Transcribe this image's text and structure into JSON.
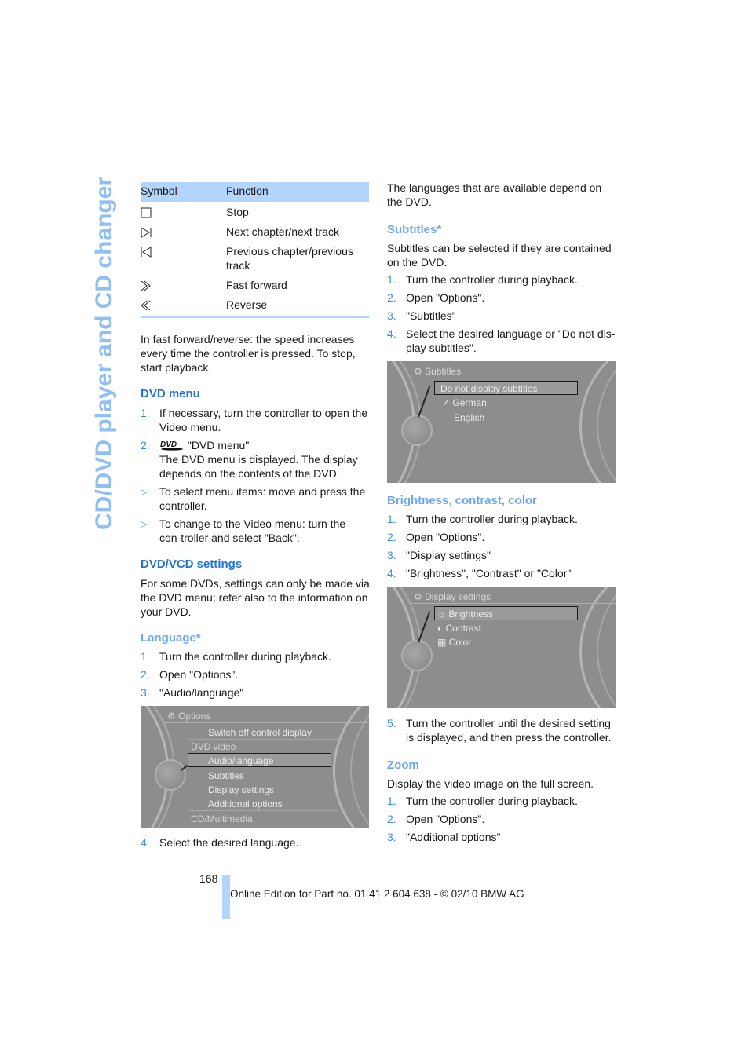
{
  "side_title": "CD/DVD player and CD changer",
  "symbol_table": {
    "headers": [
      "Symbol",
      "Function"
    ],
    "rows": [
      {
        "icon": "stop-icon",
        "function": "Stop"
      },
      {
        "icon": "next-track-icon",
        "function": "Next chapter/next track"
      },
      {
        "icon": "previous-track-icon",
        "function": "Previous chapter/previous track"
      },
      {
        "icon": "fast-forward-icon",
        "function": "Fast forward"
      },
      {
        "icon": "reverse-icon",
        "function": "Reverse"
      }
    ]
  },
  "left": {
    "intro": "In fast forward/reverse: the speed increases every time the controller is pressed. To stop, start playback.",
    "dvd_menu": {
      "heading": "DVD menu",
      "steps": [
        {
          "num": "1.",
          "text": "If necessary, turn the controller to open the Video menu."
        },
        {
          "num": "2.",
          "text": "\"DVD menu\"",
          "sub": "The DVD menu is displayed. The display depends on the contents of the DVD."
        }
      ],
      "bullets": [
        "To select menu items: move and press the controller.",
        "To change to the Video menu: turn the con-troller and select \"Back\"."
      ]
    },
    "dvd_vcd": {
      "heading": "DVD/VCD settings",
      "text": "For some DVDs, settings can only be made via the DVD menu; refer also to the information on your DVD."
    },
    "language": {
      "heading": "Language*",
      "steps": [
        {
          "num": "1.",
          "text": "Turn the controller during playback."
        },
        {
          "num": "2.",
          "text": "Open \"Options\"."
        },
        {
          "num": "3.",
          "text": "\"Audio/language\""
        }
      ],
      "screen": {
        "title": "Options",
        "items": [
          "Switch off control display",
          "DVD video",
          "Audio/language",
          "Subtitles",
          "Display settings",
          "Additional options",
          "CD/Multimedia"
        ],
        "selected": "Audio/language"
      },
      "after": {
        "num": "4.",
        "text": "Select the desired language."
      }
    }
  },
  "right": {
    "intro": "The languages that are available depend on the DVD.",
    "subtitles": {
      "heading": "Subtitles*",
      "text": "Subtitles can be selected if they are contained on the DVD.",
      "steps": [
        {
          "num": "1.",
          "text": "Turn the controller during playback."
        },
        {
          "num": "2.",
          "text": "Open \"Options\"."
        },
        {
          "num": "3.",
          "text": "\"Subtitles\""
        },
        {
          "num": "4.",
          "text": "Select the desired language or \"Do not dis-play subtitles\"."
        }
      ],
      "screen": {
        "title": "Subtitles",
        "items": [
          "Do not display subtitles",
          "German",
          "English"
        ],
        "selected": "Do not display subtitles",
        "checked": "German"
      }
    },
    "brightness": {
      "heading": "Brightness, contrast, color",
      "steps": [
        {
          "num": "1.",
          "text": "Turn the controller during playback."
        },
        {
          "num": "2.",
          "text": "Open \"Options\"."
        },
        {
          "num": "3.",
          "text": "\"Display settings\""
        },
        {
          "num": "4.",
          "text": "\"Brightness\", \"Contrast\" or \"Color\""
        }
      ],
      "screen": {
        "title": "Display settings",
        "items": [
          "Brightness",
          "Contrast",
          "Color"
        ],
        "selected": "Brightness"
      },
      "after": {
        "num": "5.",
        "text": "Turn the controller until the desired setting is displayed, and then press the controller."
      }
    },
    "zoom": {
      "heading": "Zoom",
      "text": "Display the video image on the full screen.",
      "steps": [
        {
          "num": "1.",
          "text": "Turn the controller during playback."
        },
        {
          "num": "2.",
          "text": "Open \"Options\"."
        },
        {
          "num": "3.",
          "text": "\"Additional options\""
        }
      ]
    }
  },
  "footer": {
    "page_number": "168",
    "text": "Online Edition for Part no. 01 41 2 604 638 - © 02/10 BMW AG"
  },
  "colors": {
    "heading": "#1f73d6",
    "subheading": "#6aa7ef",
    "accent_light": "#b4d5fb",
    "side_title": "#8fbff5"
  }
}
